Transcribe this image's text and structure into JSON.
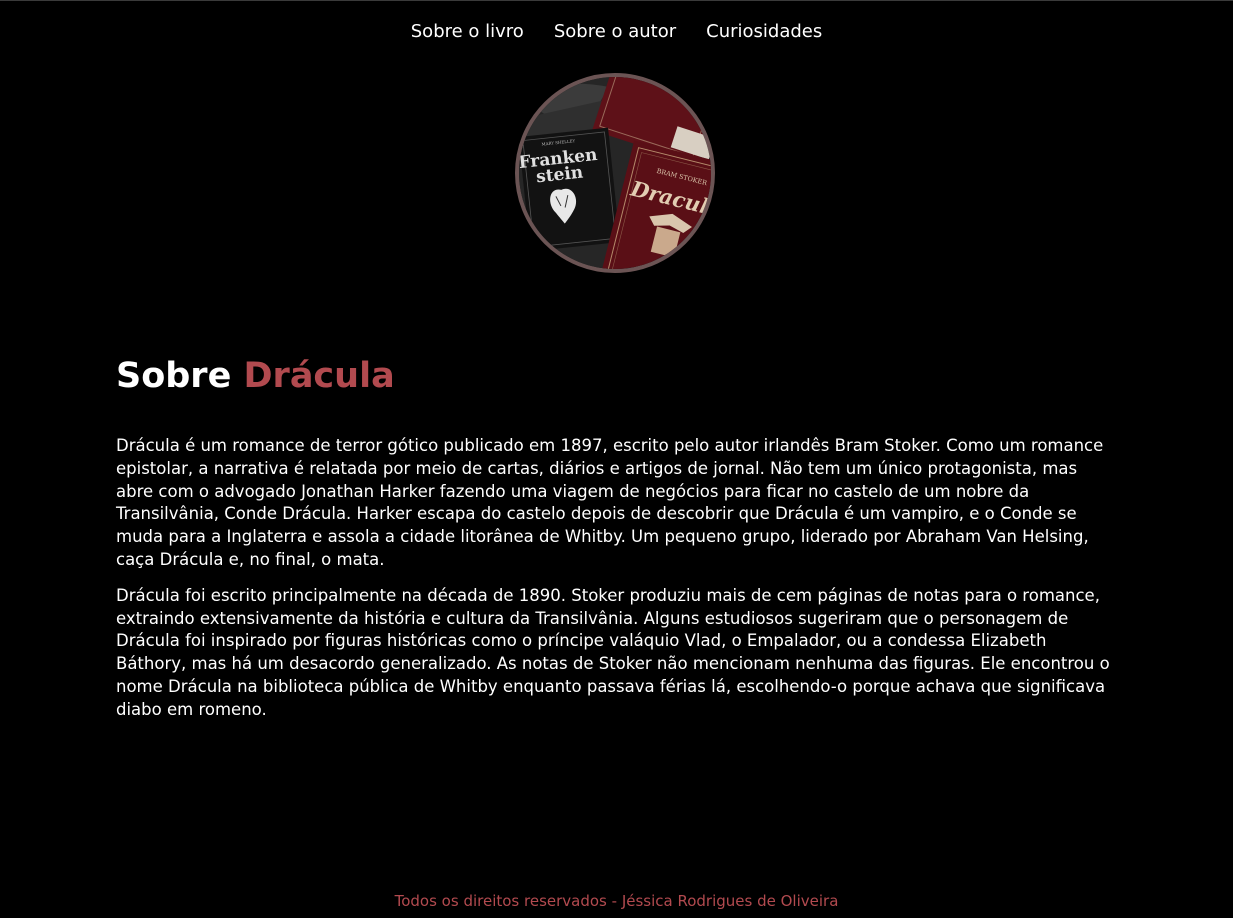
{
  "nav": {
    "items": [
      "Sobre o livro",
      "Sobre o autor",
      "Curiosidades"
    ]
  },
  "avatar": {
    "frankenstein_cover": "Frankenstein",
    "frankenstein_line1": "Franken",
    "frankenstein_line2": "stein",
    "dracula_author": "BRAM STOKER",
    "dracula_title": "Dracula"
  },
  "main": {
    "title_prefix": "Sobre",
    "title_highlight": "Drácula",
    "paragraphs": [
      "Drácula é um romance de terror gótico publicado em 1897, escrito pelo autor irlandês Bram Stoker. Como um romance epistolar, a narrativa é relatada por meio de cartas, diários e artigos de jornal. Não tem um único protagonista, mas abre com o advogado Jonathan Harker fazendo uma viagem de negócios para ficar no castelo de um nobre da Transilvânia, Conde Drácula. Harker escapa do castelo depois de descobrir que Drácula é um vampiro, e o Conde se muda para a Inglaterra e assola a cidade litorânea de Whitby. Um pequeno grupo, liderado por Abraham Van Helsing, caça Drácula e, no final, o mata.",
      "Drácula foi escrito principalmente na década de 1890. Stoker produziu mais de cem páginas de notas para o romance, extraindo extensivamente da história e cultura da Transilvânia. Alguns estudiosos sugeriram que o personagem de Drácula foi inspirado por figuras históricas como o príncipe valáquio Vlad, o Empalador, ou a condessa Elizabeth Báthory, mas há um desacordo generalizado. As notas de Stoker não mencionam nenhuma das figuras. Ele encontrou o nome Drácula na biblioteca pública de Whitby enquanto passava férias lá, escolhendo-o porque achava que significava diabo em romeno."
    ]
  },
  "footer": {
    "text": "Todos os direitos reservados - Jéssica Rodrigues de Oliveira"
  },
  "colors": {
    "background": "#000000",
    "accent": "#b24a4f",
    "avatar_border": "#6b5454",
    "text": "#ffffff"
  }
}
